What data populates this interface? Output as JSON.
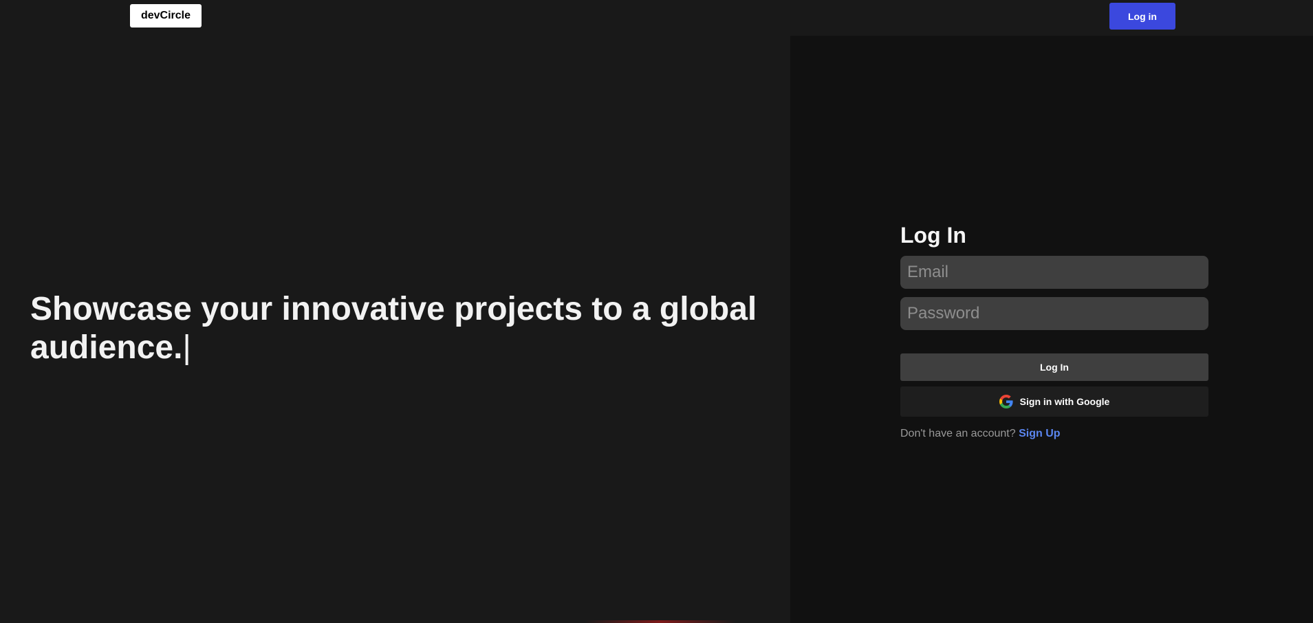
{
  "header": {
    "logo_text": "devCircle",
    "login_button": "Log in"
  },
  "hero": {
    "headline": "Showcase your innovative projects to a global audience.",
    "cursor": "|"
  },
  "login_form": {
    "title": "Log In",
    "email_placeholder": "Email",
    "password_placeholder": "Password",
    "submit_label": "Log In",
    "google_label": "Sign in with Google",
    "google_icon": "google-g-icon",
    "signup_prompt": "Don't have an account?",
    "signup_link": "Sign Up"
  },
  "colors": {
    "page_background": "#191919",
    "panel_background": "#111111",
    "primary_button": "#3b48de",
    "input_background": "#3f3f3f",
    "link": "#5b86f0"
  }
}
